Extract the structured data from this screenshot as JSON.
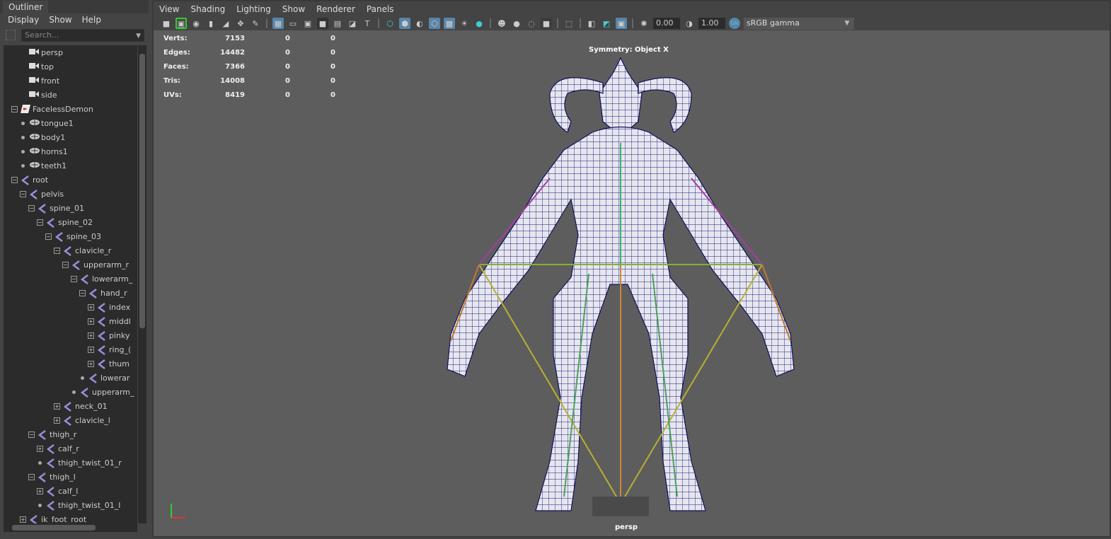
{
  "outliner": {
    "tab": "Outliner",
    "menu": [
      "Display",
      "Show",
      "Help"
    ],
    "search_placeholder": "Search...",
    "items": [
      {
        "label": "persp",
        "type": "camera",
        "depth": 2,
        "state": "none"
      },
      {
        "label": "top",
        "type": "camera",
        "depth": 2,
        "state": "none"
      },
      {
        "label": "front",
        "type": "camera",
        "depth": 2,
        "state": "none"
      },
      {
        "label": "side",
        "type": "camera",
        "depth": 2,
        "state": "none"
      },
      {
        "label": "FacelessDemon",
        "type": "set",
        "depth": 1,
        "state": "minus"
      },
      {
        "label": "tongue1",
        "type": "mesh",
        "depth": 2,
        "state": "leaf"
      },
      {
        "label": "body1",
        "type": "mesh",
        "depth": 2,
        "state": "leaf"
      },
      {
        "label": "horns1",
        "type": "mesh",
        "depth": 2,
        "state": "leaf"
      },
      {
        "label": "teeth1",
        "type": "mesh",
        "depth": 2,
        "state": "leaf"
      },
      {
        "label": "root",
        "type": "joint",
        "depth": 1,
        "state": "minus"
      },
      {
        "label": "pelvis",
        "type": "joint",
        "depth": 2,
        "state": "minus"
      },
      {
        "label": "spine_01",
        "type": "joint",
        "depth": 3,
        "state": "minus"
      },
      {
        "label": "spine_02",
        "type": "joint",
        "depth": 4,
        "state": "minus"
      },
      {
        "label": "spine_03",
        "type": "joint",
        "depth": 5,
        "state": "minus"
      },
      {
        "label": "clavicle_r",
        "type": "joint",
        "depth": 6,
        "state": "minus"
      },
      {
        "label": "upperarm_r",
        "type": "joint",
        "depth": 7,
        "state": "minus"
      },
      {
        "label": "lowerarm_",
        "type": "joint",
        "depth": 8,
        "state": "minus"
      },
      {
        "label": "hand_r",
        "type": "joint",
        "depth": 9,
        "state": "minus"
      },
      {
        "label": "index",
        "type": "joint",
        "depth": 10,
        "state": "plus"
      },
      {
        "label": "middl",
        "type": "joint",
        "depth": 10,
        "state": "plus"
      },
      {
        "label": "pinky",
        "type": "joint",
        "depth": 10,
        "state": "plus"
      },
      {
        "label": "ring_(",
        "type": "joint",
        "depth": 10,
        "state": "plus"
      },
      {
        "label": "thum",
        "type": "joint",
        "depth": 10,
        "state": "plus"
      },
      {
        "label": "lowerar",
        "type": "joint",
        "depth": 9,
        "state": "leaf"
      },
      {
        "label": "upperarm_",
        "type": "joint",
        "depth": 8,
        "state": "leaf"
      },
      {
        "label": "neck_01",
        "type": "joint",
        "depth": 6,
        "state": "plus"
      },
      {
        "label": "clavicle_l",
        "type": "joint",
        "depth": 6,
        "state": "plus"
      },
      {
        "label": "thigh_r",
        "type": "joint",
        "depth": 3,
        "state": "minus"
      },
      {
        "label": "calf_r",
        "type": "joint",
        "depth": 4,
        "state": "plus"
      },
      {
        "label": "thigh_twist_01_r",
        "type": "joint",
        "depth": 4,
        "state": "leaf"
      },
      {
        "label": "thigh_l",
        "type": "joint",
        "depth": 3,
        "state": "minus"
      },
      {
        "label": "calf_l",
        "type": "joint",
        "depth": 4,
        "state": "plus"
      },
      {
        "label": "thigh_twist_01_l",
        "type": "joint",
        "depth": 4,
        "state": "leaf"
      },
      {
        "label": "ik_foot_root",
        "type": "joint",
        "depth": 2,
        "state": "plus"
      }
    ]
  },
  "viewport": {
    "menu": [
      "View",
      "Shading",
      "Lighting",
      "Show",
      "Renderer",
      "Panels"
    ],
    "exposure": "0.00",
    "gamma": "1.00",
    "color_space": "sRGB gamma",
    "symmetry": "Symmetry: Object X",
    "camera": "persp",
    "hud": [
      {
        "label": "Verts:",
        "value": "7153",
        "a": "0",
        "b": "0"
      },
      {
        "label": "Edges:",
        "value": "14482",
        "a": "0",
        "b": "0"
      },
      {
        "label": "Faces:",
        "value": "7366",
        "a": "0",
        "b": "0"
      },
      {
        "label": "Tris:",
        "value": "14008",
        "a": "0",
        "b": "0"
      },
      {
        "label": "UVs:",
        "value": "8419",
        "a": "0",
        "b": "0"
      }
    ],
    "wire_color": "#1a1a7a",
    "mesh_color": "#e8e8ee"
  }
}
